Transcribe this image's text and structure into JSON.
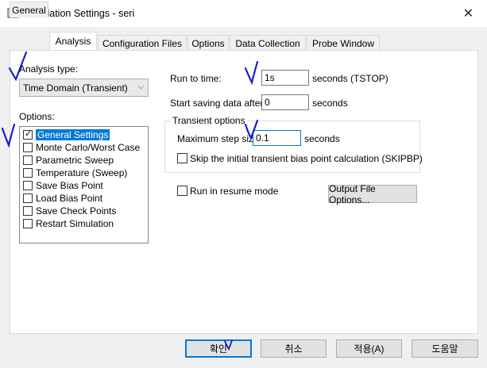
{
  "window": {
    "title": "Simulation Settings - seri",
    "close_glyph": "✕"
  },
  "tabs": [
    {
      "label": "General"
    },
    {
      "label": "Analysis"
    },
    {
      "label": "Configuration Files"
    },
    {
      "label": "Options"
    },
    {
      "label": "Data Collection"
    },
    {
      "label": "Probe Window"
    }
  ],
  "active_tab": "Analysis",
  "analysis": {
    "type_label": "Analysis type:",
    "type_value": "Time Domain (Transient)",
    "options_label": "Options:",
    "options": [
      {
        "label": "General Settings",
        "checked": true,
        "selected": true
      },
      {
        "label": "Monte Carlo/Worst Case",
        "checked": false
      },
      {
        "label": "Parametric Sweep",
        "checked": false
      },
      {
        "label": "Temperature (Sweep)",
        "checked": false
      },
      {
        "label": "Save Bias Point",
        "checked": false
      },
      {
        "label": "Load Bias Point",
        "checked": false
      },
      {
        "label": "Save Check Points",
        "checked": false
      },
      {
        "label": "Restart Simulation",
        "checked": false
      }
    ]
  },
  "run": {
    "run_to_label": "Run to time:",
    "run_to_value": "1s",
    "run_to_unit": "seconds (TSTOP)",
    "start_saving_label": "Start saving data after:",
    "start_saving_value": "0",
    "start_saving_unit": "seconds"
  },
  "transient": {
    "group_title": "Transient options",
    "max_step_label": "Maximum step size:",
    "max_step_value": "0.1",
    "max_step_unit": "seconds",
    "skip_label": "Skip the initial transient bias point calculation  (SKIPBP)",
    "skip_checked": false
  },
  "resume": {
    "label": "Run in resume mode",
    "checked": false
  },
  "output_file_options_label": "Output File Options...",
  "buttons": {
    "ok": "확인",
    "cancel": "취소",
    "apply": "적용(A)",
    "help": "도움말"
  },
  "colors": {
    "accent": "#0078d7",
    "annotation_ink": "#1c1ccc"
  }
}
